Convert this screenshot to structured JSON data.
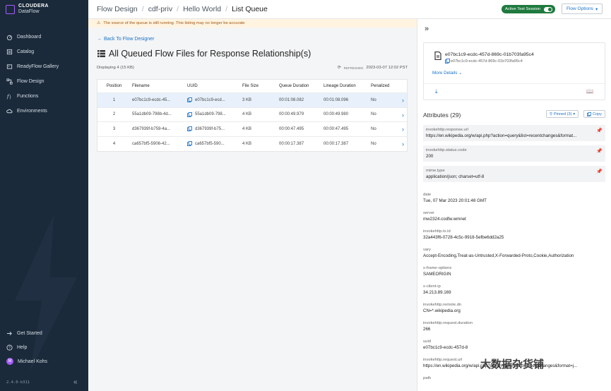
{
  "brand": {
    "line1": "CLOUDERA",
    "line2": "DataFlow"
  },
  "nav": [
    {
      "label": "Dashboard",
      "icon": "dashboard-icon"
    },
    {
      "label": "Catalog",
      "icon": "catalog-icon"
    },
    {
      "label": "ReadyFlow Gallery",
      "icon": "gallery-icon"
    },
    {
      "label": "Flow Design",
      "icon": "flow-design-icon"
    },
    {
      "label": "Functions",
      "icon": "functions-icon"
    },
    {
      "label": "Environments",
      "icon": "environments-icon"
    }
  ],
  "nav_bottom": [
    {
      "label": "Get Started"
    },
    {
      "label": "Help"
    },
    {
      "label": "Michael Kohs",
      "avatar": "M"
    }
  ],
  "version": "2.4.0-b311",
  "breadcrumb": [
    "Flow Design",
    "cdf-priv",
    "Hello World",
    "List Queue"
  ],
  "session": {
    "label": "Active Test Session"
  },
  "flow_options": {
    "label": "Flow Options"
  },
  "warning": "The source of the queue is still running. This listing may no longer be accurate",
  "back_link": "Back To Flow Designer",
  "page_title": "All Queued Flow Files for Response Relationship(s)",
  "displaying": "Displaying 4 (15 KB)",
  "refreshed": {
    "label": "Refreshed",
    "time": "2023-03-07 12:02 PST"
  },
  "table": {
    "headers": [
      "Position",
      "Filename",
      "UUID",
      "File Size",
      "Queue Duration",
      "Lineage Duration",
      "Penalized"
    ],
    "rows": [
      [
        "1",
        "e07bc1c9-ecdc-45...",
        "e07bc1c9-ecd...",
        "3 KB",
        "00:01:08.082",
        "00:01:08.096",
        "No"
      ],
      [
        "2",
        "55a1db09-798b-4d...",
        "55a1db09-798...",
        "4 KB",
        "00:00:49.979",
        "00:00:49.980",
        "No"
      ],
      [
        "3",
        "d367939f-b759-4a...",
        "d367939f-b75...",
        "4 KB",
        "00:00:47.495",
        "00:00:47.495",
        "No"
      ],
      [
        "4",
        "ca657bf5-5906-42...",
        "ca657bf5-590...",
        "4 KB",
        "00:00:17.387",
        "00:00:17.387",
        "No"
      ]
    ]
  },
  "panel": {
    "filename": "e07bc1c9-ecdc-457d-869c-01b703fa95c4",
    "uuid": "e07bc1c9-ecdc-457d-869c-01b703fa95c4",
    "more_details": "More Details",
    "attributes_title": "Attributes (29)",
    "pinned_label": "Pinned (3)",
    "copy_label": "Copy",
    "pinned_attrs": [
      {
        "key": "invokehttp.response.url",
        "value": "https://en.wikipedia.org/w/api.php?action=query&list=recentchanges&format..."
      },
      {
        "key": "invokehttp.status.code",
        "value": "200"
      },
      {
        "key": "mime.type",
        "value": "application/json; charset=utf-8"
      }
    ],
    "attrs": [
      {
        "key": "date",
        "value": "Tue, 07 Mar 2023 20:01:48 GMT"
      },
      {
        "key": "server",
        "value": "mw2324.codfw.wmnet"
      },
      {
        "key": "invokehttp.tx.id",
        "value": "32a443f6-0728-4c5c-9918-5efbe6dd2a25"
      },
      {
        "key": "vary",
        "value": "Accept-Encoding,Treat-as-Untrusted,X-Forwarded-Proto,Cookie,Authorization"
      },
      {
        "key": "x-frame-options",
        "value": "SAMEORIGIN"
      },
      {
        "key": "x-client-ip",
        "value": "34.213.89.169"
      },
      {
        "key": "invokehttp.remote.dn",
        "value": "CN=*.wikipedia.org"
      },
      {
        "key": "invokehttp.request.duration",
        "value": "266"
      },
      {
        "key": "uuid",
        "value": "e07bc1c9-ecdc-457d-8"
      },
      {
        "key": "invokehttp.request.url",
        "value": "https://en.wikipedia.org/w/api.php?action=query&list=recentchanges&format=j..."
      },
      {
        "key": "path",
        "value": ""
      }
    ]
  },
  "watermark": "大数据杂货铺",
  "colors": {
    "sidebar": "#1b2a3a",
    "accent": "#1a73c8",
    "brand": "#a45cff",
    "session": "#1f7a3e"
  }
}
